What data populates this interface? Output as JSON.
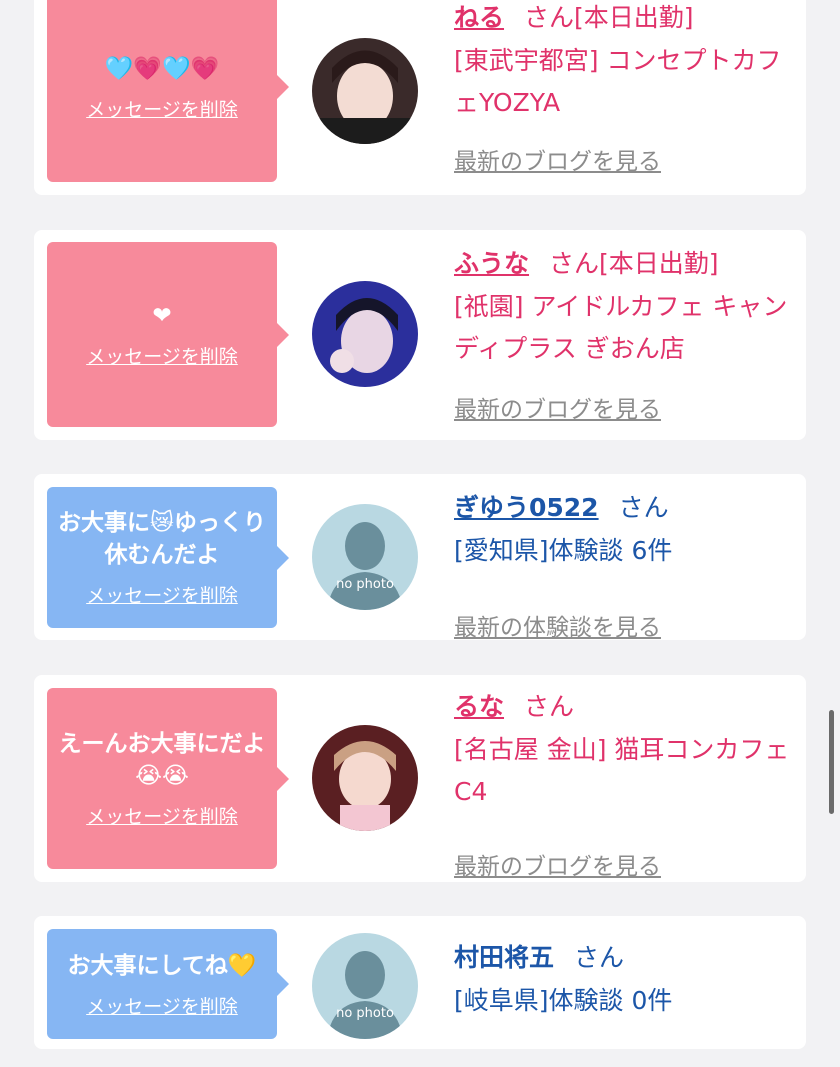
{
  "cards": [
    {
      "message": "🩵💗🩵💗",
      "delete_label": "メッセージを削除",
      "name": "ねる",
      "honorific": "さん",
      "status": "[本日出勤]",
      "shop": "[東武宇都宮] コンセプトカフェYOZYA",
      "link": "最新のブログを見る"
    },
    {
      "message": "❤",
      "delete_label": "メッセージを削除",
      "name": "ふうな",
      "honorific": "さん",
      "status": "[本日出勤]",
      "shop": "[祇園] アイドルカフェ キャンディプラス ぎおん店",
      "link": "最新のブログを見る"
    },
    {
      "message": "お大事に😿ゆっくり休むんだよ",
      "delete_label": "メッセージを削除",
      "name": "ぎゆう0522",
      "honorific": "さん",
      "shop": "[愛知県]体験談 6件",
      "link": "最新の体験談を見る",
      "avatar_text": "no photo"
    },
    {
      "message": "えーんお大事にだよ😭😭",
      "delete_label": "メッセージを削除",
      "name": "るな",
      "honorific": "さん",
      "shop": "[名古屋 金山] 猫耳コンカフェ C4",
      "link": "最新のブログを見る"
    },
    {
      "message": "お大事にしてね💛",
      "delete_label": "メッセージを削除",
      "name": "村田将五",
      "honorific": "さん",
      "shop": "[岐阜県]体験談 0件",
      "avatar_text": "no photo"
    }
  ],
  "colors": {
    "pink_bubble": "#f78a9b",
    "blue_bubble": "#86b6f3",
    "pink_text": "#e0326a",
    "blue_text": "#1c56a8"
  }
}
